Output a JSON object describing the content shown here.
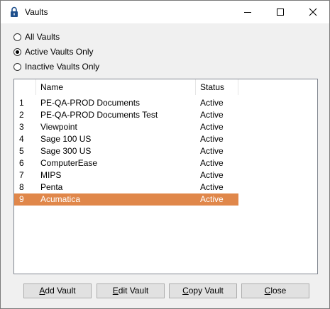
{
  "window": {
    "title": "Vaults"
  },
  "filters": [
    {
      "label": "All Vaults",
      "selected": false
    },
    {
      "label": "Active Vaults Only",
      "selected": true
    },
    {
      "label": "Inactive Vaults Only",
      "selected": false
    }
  ],
  "table": {
    "columns": [
      "Name",
      "Status"
    ],
    "rows": [
      {
        "num": "1",
        "name": "PE-QA-PROD Documents",
        "status": "Active"
      },
      {
        "num": "2",
        "name": "PE-QA-PROD Documents Test",
        "status": "Active"
      },
      {
        "num": "3",
        "name": "Viewpoint",
        "status": "Active"
      },
      {
        "num": "4",
        "name": "Sage 100 US",
        "status": "Active"
      },
      {
        "num": "5",
        "name": "Sage 300 US",
        "status": "Active"
      },
      {
        "num": "6",
        "name": "ComputerEase",
        "status": "Active"
      },
      {
        "num": "7",
        "name": "MIPS",
        "status": "Active"
      },
      {
        "num": "8",
        "name": "Penta",
        "status": "Active"
      },
      {
        "num": "9",
        "name": "Acumatica",
        "status": "Active"
      }
    ],
    "selected_row": "9"
  },
  "buttons": {
    "add": {
      "accel": "A",
      "rest": "dd Vault"
    },
    "edit": {
      "accel": "E",
      "rest": "dit Vault"
    },
    "copy": {
      "accel": "C",
      "rest": "opy Vault"
    },
    "close": {
      "accel": "C",
      "rest": "lose"
    }
  },
  "colors": {
    "selection": "#e0874a",
    "window_bg": "#f0f0f0",
    "icon_blue": "#1e4f8c"
  },
  "icons": {
    "title": "padlock-icon",
    "minimize": "minimize-icon",
    "maximize": "maximize-icon",
    "close": "close-icon"
  }
}
